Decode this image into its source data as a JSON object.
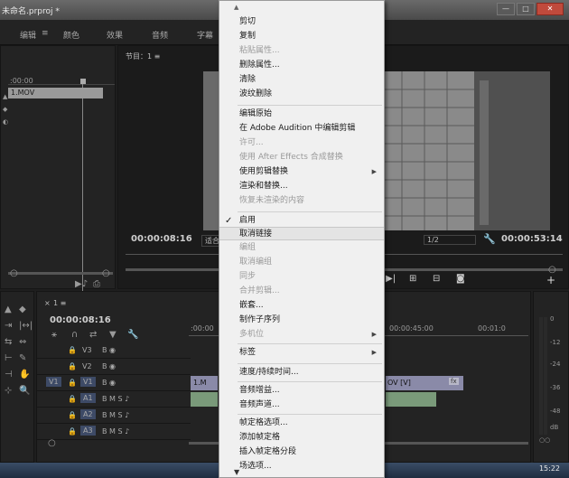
{
  "window": {
    "title": "未命名.prproj *",
    "btn_min": "—",
    "btn_max": "□",
    "btn_close": "✕"
  },
  "workspaces": [
    "编辑",
    "≡",
    "颜色",
    "效果",
    "音频",
    "字幕"
  ],
  "source": {
    "ruler_tc": ":00:00",
    "clip_name": "1.MOV"
  },
  "program": {
    "tab": "节目：1  ≡",
    "timecode": "00:00:08:16",
    "fit": "适合",
    "quality": "1/2",
    "duration": "00:00:53:14"
  },
  "timeline": {
    "tab": "1  ≡",
    "timecode": "00:00:08:16",
    "ruler": [
      ":00:00",
      "00:00:45:00",
      "00:01:0"
    ],
    "tracks": [
      {
        "src": "",
        "name": "V3",
        "icons": "B ◉"
      },
      {
        "src": "",
        "name": "V2",
        "icons": "B ◉"
      },
      {
        "src": "V1",
        "name": "V1",
        "icons": "B ◉"
      },
      {
        "src": "A1",
        "name": "A1",
        "icons": "B M S ♪"
      },
      {
        "src": "",
        "name": "A2",
        "icons": "B M S ♪"
      },
      {
        "src": "",
        "name": "A3",
        "icons": "B M S ♪"
      }
    ],
    "clip_v1_label": "1.M",
    "clip_v1_tail": "OV [V]",
    "fx_badge": "fx"
  },
  "meter": {
    "labels": [
      "0",
      "-12",
      "-24",
      "-36",
      "-48",
      "dB"
    ]
  },
  "context_menu": {
    "items": [
      {
        "label": "剪切",
        "enabled": true
      },
      {
        "label": "复制",
        "enabled": true
      },
      {
        "label": "粘贴属性...",
        "enabled": false
      },
      {
        "label": "删除属性...",
        "enabled": true
      },
      {
        "label": "清除",
        "enabled": true
      },
      {
        "label": "波纹删除",
        "enabled": true
      },
      {
        "label": "编辑原始",
        "enabled": true
      },
      {
        "label": "在 Adobe Audition 中编辑剪辑",
        "enabled": true
      },
      {
        "label": "许可...",
        "enabled": false
      },
      {
        "label": "使用 After Effects 合成替换",
        "enabled": false
      },
      {
        "label": "使用剪辑替换",
        "enabled": true,
        "submenu": true
      },
      {
        "label": "渲染和替换...",
        "enabled": true
      },
      {
        "label": "恢复未渲染的内容",
        "enabled": false
      },
      {
        "label": "启用",
        "enabled": true,
        "checked": true
      },
      {
        "label": "取消链接",
        "enabled": true,
        "highlighted": true
      },
      {
        "label": "编组",
        "enabled": false
      },
      {
        "label": "取消编组",
        "enabled": false
      },
      {
        "label": "同步",
        "enabled": false
      },
      {
        "label": "合并剪辑...",
        "enabled": false
      },
      {
        "label": "嵌套...",
        "enabled": true
      },
      {
        "label": "制作子序列",
        "enabled": true
      },
      {
        "label": "多机位",
        "enabled": false,
        "submenu": true
      },
      {
        "label": "标签",
        "enabled": true,
        "submenu": true
      },
      {
        "label": "速度/持续时间...",
        "enabled": true
      },
      {
        "label": "音频增益...",
        "enabled": true
      },
      {
        "label": "音频声道...",
        "enabled": true
      },
      {
        "label": "帧定格选项...",
        "enabled": true
      },
      {
        "label": "添加帧定格",
        "enabled": true
      },
      {
        "label": "插入帧定格分段",
        "enabled": true
      },
      {
        "label": "场选项...",
        "enabled": true
      }
    ],
    "scroll_up": "▲",
    "scroll_down": "▼",
    "submenu_arrow": "▶",
    "check_mark": "✓"
  },
  "taskbar": {
    "time": "15:22"
  },
  "colors": {
    "clip_video": "#8a8aa8",
    "clip_audio": "#7a9a7a",
    "highlight": "#e4e4e4"
  }
}
